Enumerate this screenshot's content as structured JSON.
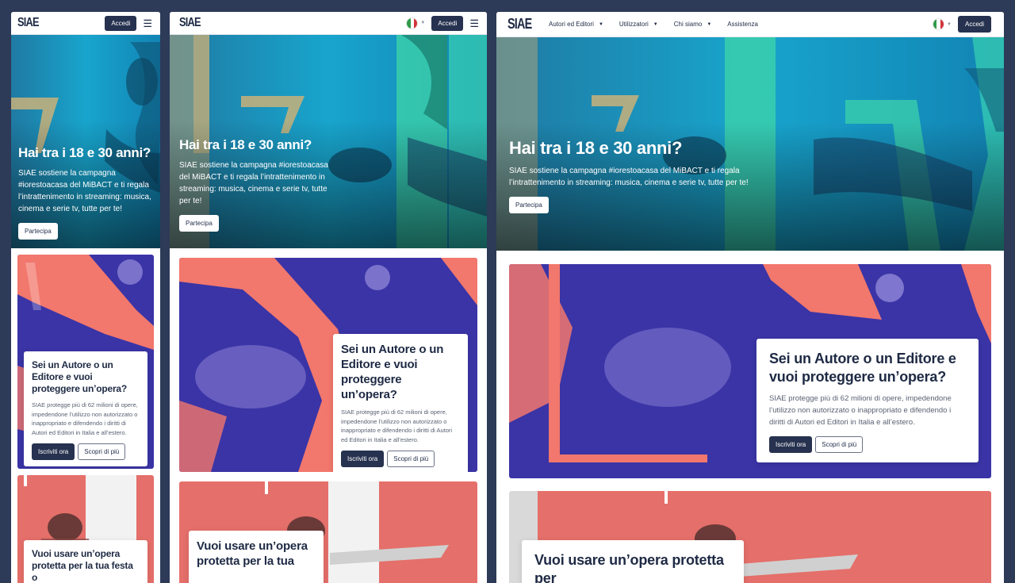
{
  "brand": {
    "logo": "SIAE"
  },
  "nav": {
    "login": "Accedi",
    "menu": [
      {
        "label": "Autori ed Editori",
        "dropdown": true
      },
      {
        "label": "Utilizzatori",
        "dropdown": true
      },
      {
        "label": "Chi siamo",
        "dropdown": true
      },
      {
        "label": "Assistenza",
        "dropdown": false
      }
    ],
    "language_flag": "italy-flag-icon"
  },
  "hero": {
    "title": "Hai tra i 18 e 30 anni?",
    "description": "SIAE sostiene la campagna #iorestoacasa del MiBACT e ti regala l’intrattenimento in streaming: musica, cinema e serie tv, tutte per te!",
    "button": "Partecipa"
  },
  "card_protect": {
    "title": "Sei un Autore o un Editore e vuoi proteggere un’opera?",
    "description": "SIAE protegge più di 62 milioni di opere, impedendone l’utilizzo non autorizzato o inappropriato e difendendo i diritti di Autori ed Editori in Italia e all’estero.",
    "primary_button": "Iscriviti ora",
    "secondary_button": "Scopri di più"
  },
  "card_use": {
    "title_small": "Vuoi usare un’opera protetta per la tua festa o",
    "title_medium": "Vuoi usare un’opera protetta per la tua",
    "title_large": "Vuoi usare un’opera protetta per"
  },
  "colors": {
    "page_bg": "#2d3a58",
    "primary": "#26324f",
    "hero_blue": "#1aa2c9",
    "hero_green": "#3fd6a8",
    "card_purple": "#3b35a8",
    "card_coral": "#f2776c"
  }
}
